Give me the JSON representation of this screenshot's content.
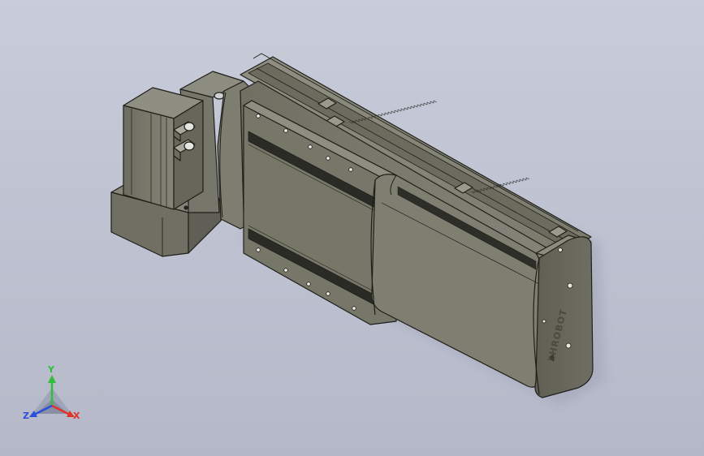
{
  "viewport": {
    "background_top": "#c9ccd9",
    "background_bottom": "#b4b8c8"
  },
  "model": {
    "body_color": "#7b7b6d",
    "body_light": "#8a8a7b",
    "body_dark": "#5a5a4f",
    "edge_color": "#1f1f1a",
    "brand": "LHROBOT"
  },
  "triad": {
    "x_label": "X",
    "y_label": "Y",
    "z_label": "Z",
    "x_color": "#e0342a",
    "y_color": "#2fbf3a",
    "z_color": "#2b4fd8"
  }
}
